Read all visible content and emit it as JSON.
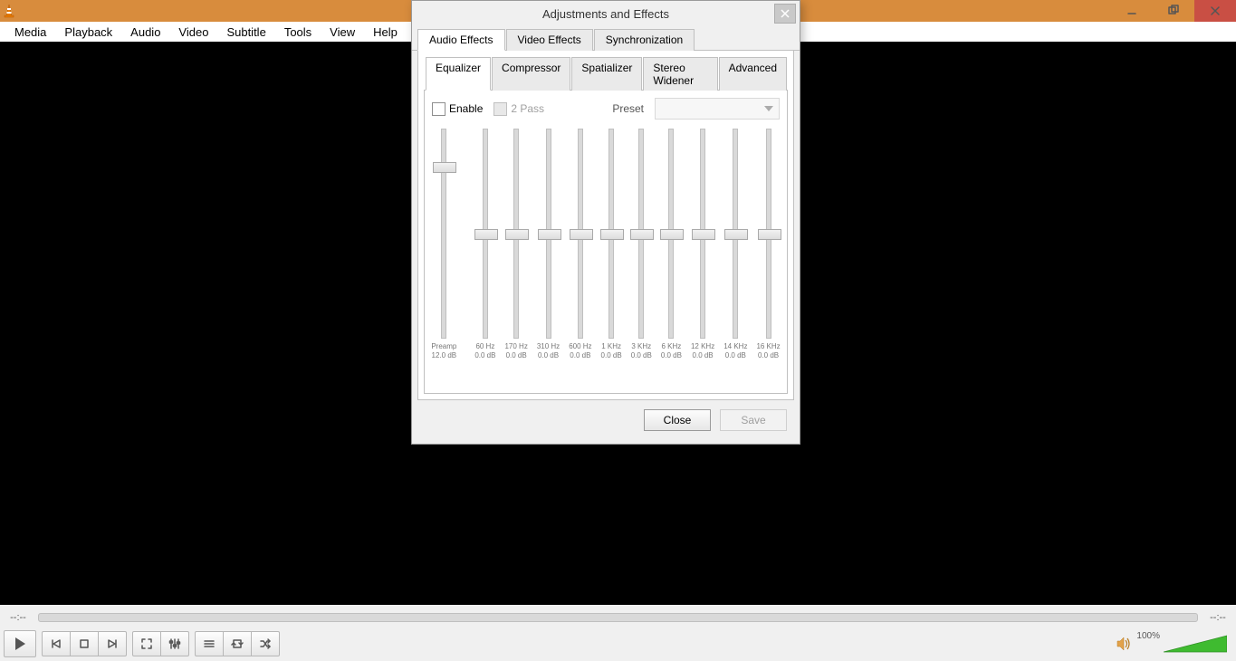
{
  "titlebar": {
    "title": ""
  },
  "menubar": [
    "Media",
    "Playback",
    "Audio",
    "Video",
    "Subtitle",
    "Tools",
    "View",
    "Help"
  ],
  "time": {
    "elapsed": "--:--",
    "total": "--:--"
  },
  "volume": {
    "percent_label": "100%"
  },
  "dialog": {
    "title": "Adjustments and Effects",
    "outer_tabs": [
      "Audio Effects",
      "Video Effects",
      "Synchronization"
    ],
    "active_outer_tab": 0,
    "inner_tabs": [
      "Equalizer",
      "Compressor",
      "Spatializer",
      "Stereo Widener",
      "Advanced"
    ],
    "active_inner_tab": 0,
    "enable_label": "Enable",
    "twopass_label": "2 Pass",
    "preset_label": "Preset",
    "preamp": {
      "label": "Preamp",
      "value_label": "12.0 dB",
      "thumb_percent": 18
    },
    "bands": [
      {
        "freq": "60 Hz",
        "value_label": "0.0 dB",
        "thumb_percent": 50
      },
      {
        "freq": "170 Hz",
        "value_label": "0.0 dB",
        "thumb_percent": 50
      },
      {
        "freq": "310 Hz",
        "value_label": "0.0 dB",
        "thumb_percent": 50
      },
      {
        "freq": "600 Hz",
        "value_label": "0.0 dB",
        "thumb_percent": 50
      },
      {
        "freq": "1 KHz",
        "value_label": "0.0 dB",
        "thumb_percent": 50
      },
      {
        "freq": "3 KHz",
        "value_label": "0.0 dB",
        "thumb_percent": 50
      },
      {
        "freq": "6 KHz",
        "value_label": "0.0 dB",
        "thumb_percent": 50
      },
      {
        "freq": "12 KHz",
        "value_label": "0.0 dB",
        "thumb_percent": 50
      },
      {
        "freq": "14 KHz",
        "value_label": "0.0 dB",
        "thumb_percent": 50
      },
      {
        "freq": "16 KHz",
        "value_label": "0.0 dB",
        "thumb_percent": 50
      }
    ],
    "close_label": "Close",
    "save_label": "Save"
  }
}
